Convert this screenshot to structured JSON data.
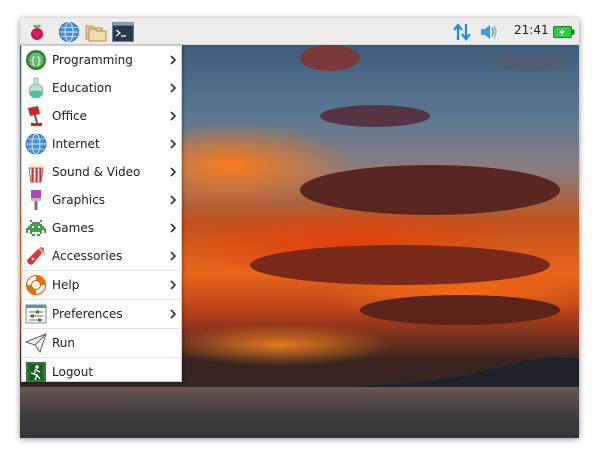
{
  "taskbar": {
    "launchers": [
      {
        "icon": "raspberry-icon"
      },
      {
        "icon": "web-browser-icon"
      },
      {
        "icon": "file-manager-icon"
      },
      {
        "icon": "terminal-icon"
      }
    ],
    "tray": {
      "network_icon": "network-arrows-icon",
      "volume_icon": "speaker-icon",
      "clock": "21:41",
      "battery_icon": "battery-charging-icon"
    },
    "accent_color": "#1a8fd8"
  },
  "menu": {
    "items": [
      {
        "label": "Programming",
        "icon": "programming-icon",
        "submenu": true
      },
      {
        "label": "Education",
        "icon": "education-flask-icon",
        "submenu": true
      },
      {
        "label": "Office",
        "icon": "office-lamp-icon",
        "submenu": true
      },
      {
        "label": "Internet",
        "icon": "internet-globe-icon",
        "submenu": true
      },
      {
        "label": "Sound & Video",
        "icon": "popcorn-icon",
        "submenu": true
      },
      {
        "label": "Graphics",
        "icon": "paintbrush-icon",
        "submenu": true
      },
      {
        "label": "Games",
        "icon": "space-invader-icon",
        "submenu": true
      },
      {
        "label": "Accessories",
        "icon": "swiss-knife-icon",
        "submenu": true
      },
      {
        "label": "Help",
        "icon": "lifebuoy-icon",
        "submenu": true
      },
      {
        "label": "Preferences",
        "icon": "preferences-icon",
        "submenu": true
      },
      {
        "label": "Run",
        "icon": "paper-plane-icon",
        "submenu": false
      },
      {
        "label": "Logout",
        "icon": "exit-icon",
        "submenu": false
      }
    ]
  }
}
